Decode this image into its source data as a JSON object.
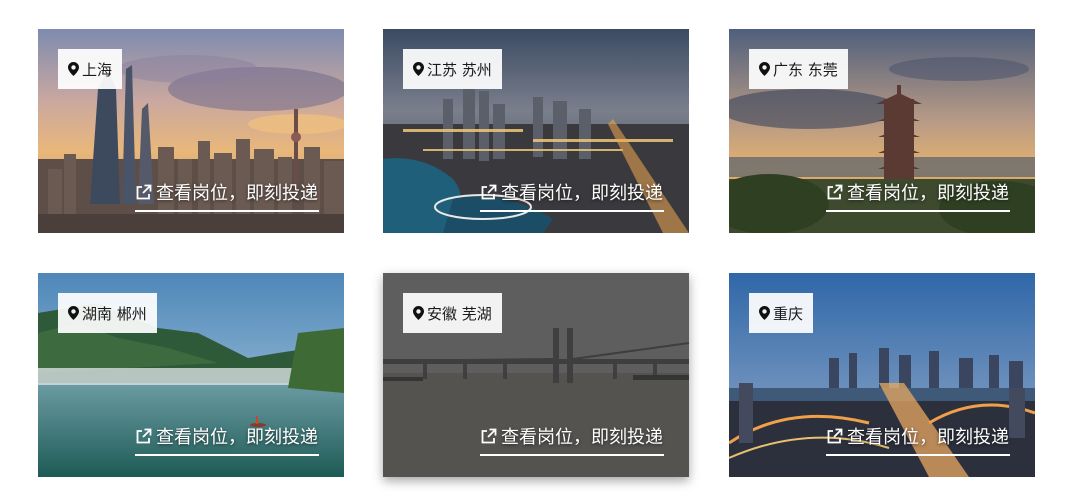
{
  "cta_label": "查看岗位，即刻投递",
  "icons": {
    "location": "map-pin-icon",
    "external": "external-link-icon"
  },
  "cards": [
    {
      "location": "上海"
    },
    {
      "location": "江苏 苏州"
    },
    {
      "location": "广东 东莞"
    },
    {
      "location": "湖南 郴州"
    },
    {
      "location": "安徽 芜湖"
    },
    {
      "location": "重庆"
    }
  ]
}
